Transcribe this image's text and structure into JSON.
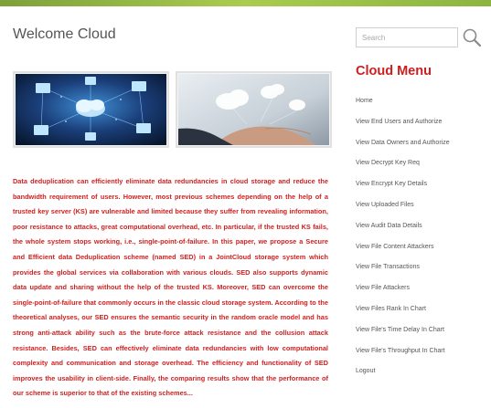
{
  "page": {
    "title": "Welcome Cloud",
    "description": "Data deduplication can efficiently eliminate data redundancies in cloud storage and reduce the bandwidth requirement of users. However, most previous schemes depending on the help of a trusted key server (KS) are vulnerable and limited because they suffer from revealing information, poor resistance to attacks, great computational overhead, etc. In particular, if the trusted KS fails, the whole system stops working, i.e., single-point-of-failure. In this paper, we propose a Secure and Efficient data Deduplication scheme (named SED) in a JointCloud storage system which provides the global services via collaboration with various clouds. SED also supports dynamic data update and sharing without the help of the trusted KS. Moreover, SED can overcome the single-point-of-failure that commonly occurs in the classic cloud storage system. According to the theoretical analyses, our SED ensures the semantic security in the random oracle model and has strong anti-attack ability such as the brute-force attack resistance and the collusion attack resistance. Besides, SED can effectively eliminate data redundancies with low computational complexity and communication and storage overhead. The efficiency and functionality of SED improves the usability in client-side. Finally, the comparing results show that the performance of our scheme is superior to that of the existing schemes..."
  },
  "search": {
    "placeholder": "Search",
    "icon": "search-icon"
  },
  "menu": {
    "title": "Cloud Menu",
    "items": [
      "Home",
      "View End Users and Authorize",
      "View Data Owners and Authorize",
      "View Decrypt Key Req",
      "View Encrypt Key Details",
      "View Uploaded Files",
      "View Audit Data Details",
      "View File Content Attackers",
      "View File Transactions",
      "View File Attackers",
      "View Files Rank In Chart",
      "View File's Time Delay In Chart",
      "View File's Throughput In Chart",
      "Logout"
    ]
  },
  "colors": {
    "accent_red": "#cc1e1e",
    "top_bar_green": "#a9cc4f",
    "text_gray": "#555555"
  }
}
